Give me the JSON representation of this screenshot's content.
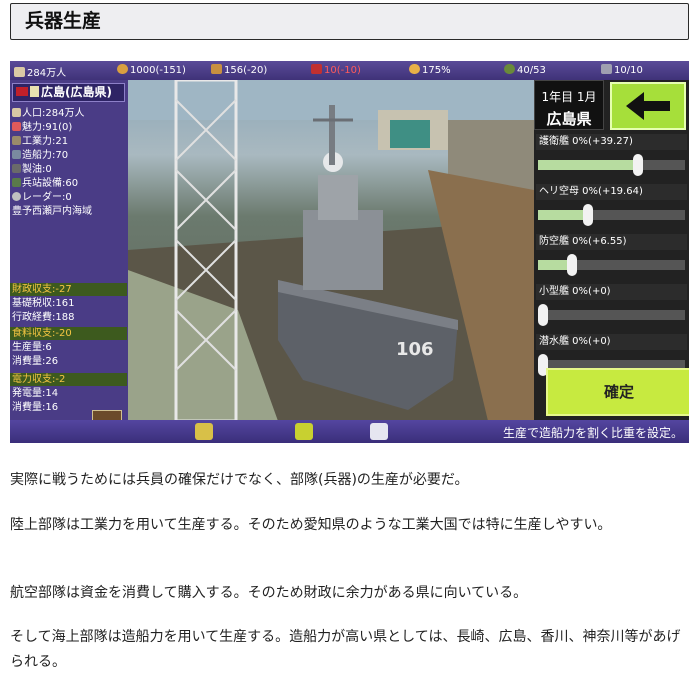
{
  "article": {
    "title": "兵器生産",
    "paragraphs": [
      "実際に戦うためには兵員の確保だけでなく、部隊(兵器)の生産が必要だ。",
      "陸上部隊は工業力を用いて生産する。そのため愛知県のような工業大国では特に生産しやすい。",
      "航空部隊は資金を消費して購入する。そのため財政に余力がある県に向いている。",
      "そして海上部隊は造船力を用いて生産する。造船力が高い県としては、長崎、広島、香川、神奈川等があげられる。"
    ]
  },
  "game": {
    "topbar": [
      {
        "icon": "population-icon",
        "value": "284万人",
        "warn": false
      },
      {
        "icon": "money-bag-icon",
        "value": "1000(-151)",
        "warn": false
      },
      {
        "icon": "bread-icon",
        "value": "156(-20)",
        "warn": false
      },
      {
        "icon": "fuel-icon",
        "value": "10(-10)",
        "warn": true
      },
      {
        "icon": "hand-icon",
        "value": "175%",
        "warn": false
      },
      {
        "icon": "soldier-icon",
        "value": "40/53",
        "warn": false
      },
      {
        "icon": "wrench-icon",
        "value": "10/10",
        "warn": false
      }
    ],
    "prefecture": {
      "name": "広島(広島県)",
      "stats": [
        {
          "icon": "population-icon",
          "label": "人口:284万人"
        },
        {
          "icon": "heart-icon",
          "label": "魅力:91(0)"
        },
        {
          "icon": "factory-icon",
          "label": "工業力:21"
        },
        {
          "icon": "ship-icon",
          "label": "造船力:70"
        },
        {
          "icon": "oil-icon",
          "label": "製油:0"
        },
        {
          "icon": "barracks-icon",
          "label": "兵站設備:60"
        },
        {
          "icon": "radar-icon",
          "label": "レーダー:0"
        }
      ],
      "region": "豊予西瀬戸内海域"
    },
    "finance": {
      "head": "財政収支:-27",
      "rows": [
        "基礎税収:161",
        "行政経費:188"
      ]
    },
    "food": {
      "head": "食料収支:-20",
      "rows": [
        "生産量:6",
        "消費量:26"
      ]
    },
    "power": {
      "head": "電力収支:-2",
      "rows": [
        "発電量:14",
        "消費量:16"
      ]
    },
    "date": {
      "line1": "1年目 1月",
      "line2": "広島県"
    },
    "sliders": [
      {
        "label": "護衛艦 0%(+39.27)",
        "value": 0.68
      },
      {
        "label": "ヘリ空母 0%(+19.64)",
        "value": 0.34
      },
      {
        "label": "防空艦 0%(+6.55)",
        "value": 0.23
      },
      {
        "label": "小型艦 0%(+0)",
        "value": 0.0
      },
      {
        "label": "潜水艦 0%(+0)",
        "value": 0.0
      }
    ],
    "confirm_label": "確定",
    "hint": "生産で造船力を割く比重を設定。",
    "colors": {
      "panel": "#4a3c86",
      "warn": "#ff5a5a",
      "section_head_text": "#f5c542",
      "confirm": "#c7ea40",
      "back_button": "#a6df3a",
      "slider_fill": "#b7dca0"
    }
  }
}
